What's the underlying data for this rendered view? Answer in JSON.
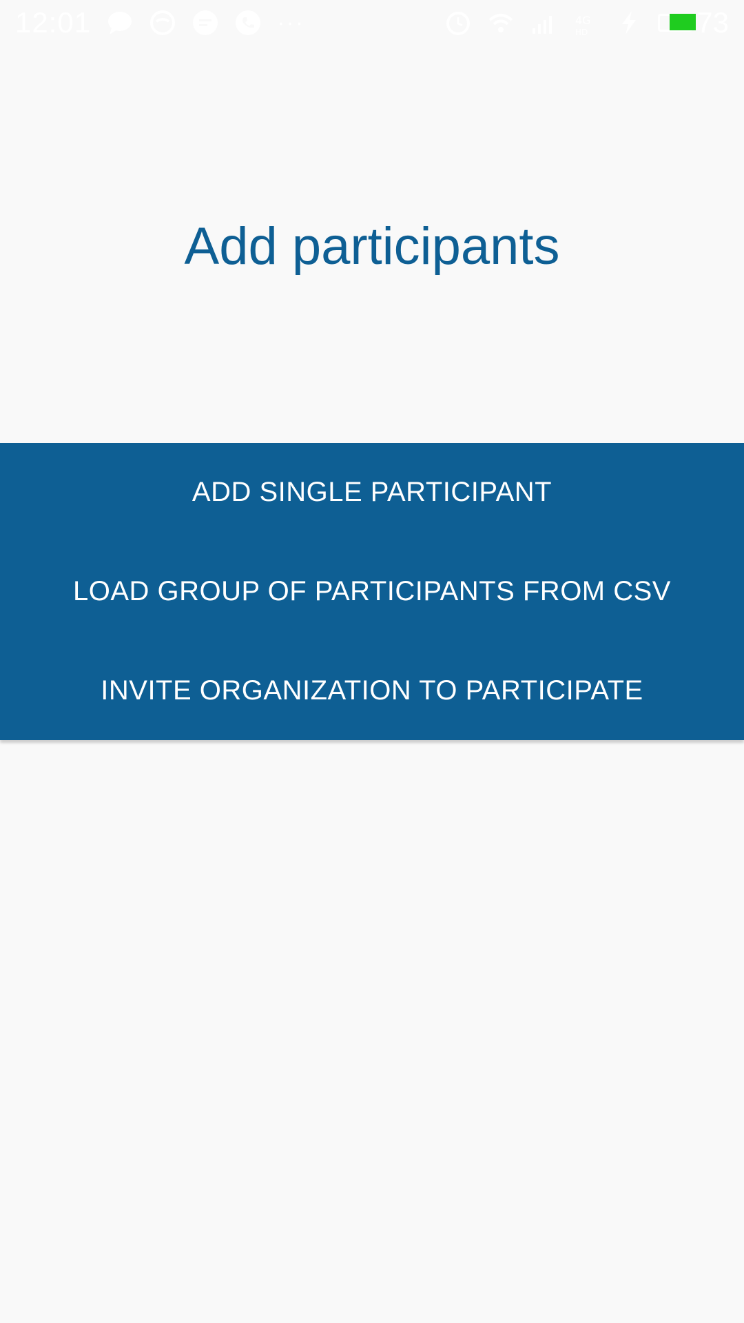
{
  "status_bar": {
    "time": "12:01",
    "notification_icons": [
      "chat-bubble-icon",
      "speech-circle-icon",
      "message-icon",
      "phone-icon"
    ],
    "overflow": "···",
    "system_icons": [
      "alarm-icon",
      "wifi-icon",
      "signal-icon",
      "4g-icon",
      "charging-icon"
    ],
    "battery_percent": "73",
    "battery_color": "#1fcc1f"
  },
  "page": {
    "title": "Add participants",
    "accent_color": "#0e5f94"
  },
  "actions": [
    {
      "label": "ADD SINGLE PARTICIPANT"
    },
    {
      "label": "LOAD GROUP OF PARTICIPANTS FROM CSV"
    },
    {
      "label": "INVITE ORGANIZATION TO PARTICIPATE"
    }
  ]
}
